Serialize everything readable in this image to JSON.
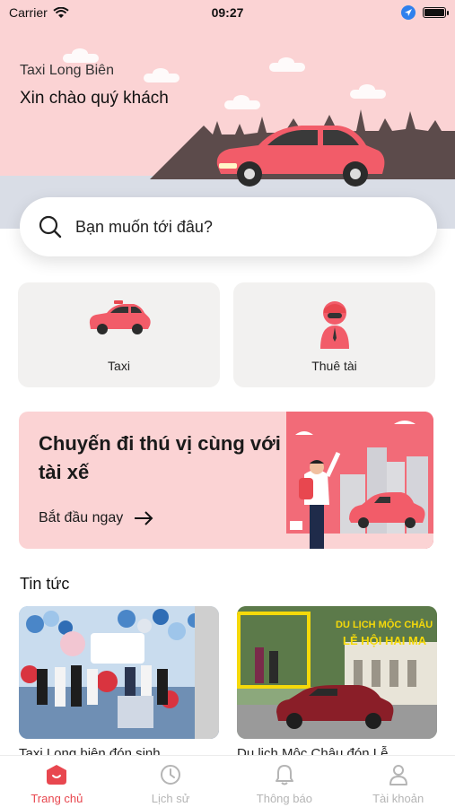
{
  "status_bar": {
    "carrier": "Carrier",
    "time": "09:27"
  },
  "header": {
    "brand": "Taxi Long Biên",
    "greeting": "Xin chào quý khách"
  },
  "search": {
    "placeholder": "Bạn muốn tới đâu?"
  },
  "services": [
    {
      "label": "Taxi",
      "icon": "car-icon"
    },
    {
      "label": "Thuê tài",
      "icon": "driver-icon"
    }
  ],
  "promo": {
    "title": "Chuyến đi thú vị cùng với tài xế",
    "cta": "Bắt đầu ngay"
  },
  "news": {
    "heading": "Tin tức",
    "items": [
      {
        "caption": "Taxi Long biên đón sinh"
      },
      {
        "caption": "Du lịch Mộc Châu đón Lễ",
        "overlay_line1": "DU LỊCH MỘC CHÂU",
        "overlay_line2": "LỄ HỘI HAI MA"
      }
    ]
  },
  "tab_bar": {
    "tabs": [
      {
        "label": "Trang chủ",
        "icon": "home-icon",
        "active": true
      },
      {
        "label": "Lịch sử",
        "icon": "clock-icon",
        "active": false
      },
      {
        "label": "Thông báo",
        "icon": "bell-icon",
        "active": false
      },
      {
        "label": "Tài khoản",
        "icon": "user-icon",
        "active": false
      }
    ]
  },
  "colors": {
    "accent": "#e8474f",
    "header_bg": "#fbd3d4",
    "card_bg": "#f2f1f0"
  }
}
